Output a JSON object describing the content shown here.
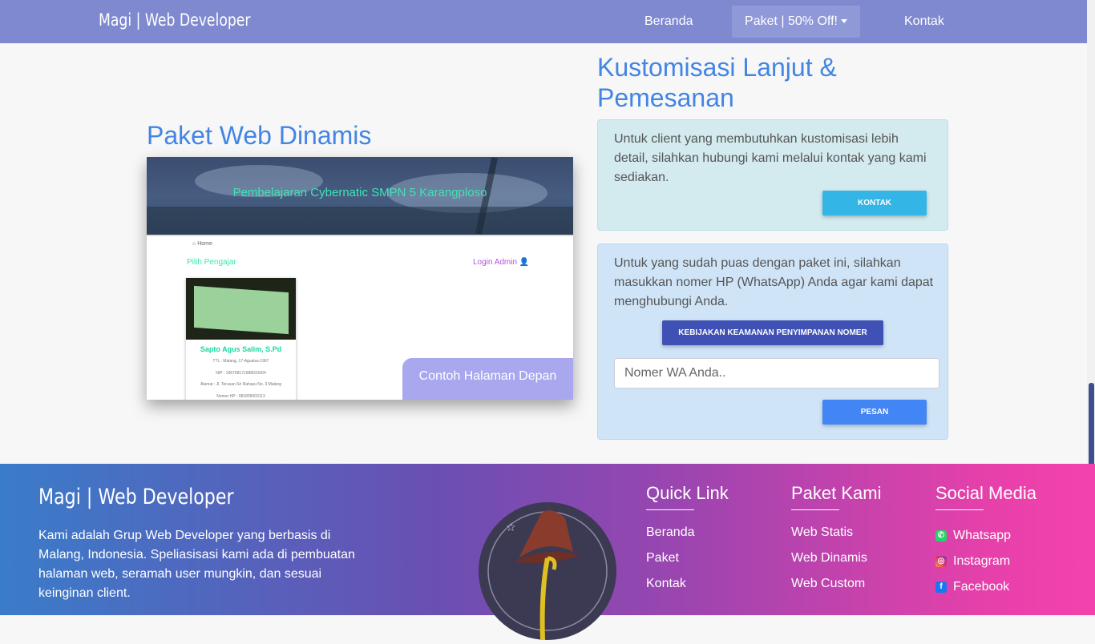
{
  "navbar": {
    "brand": "Magi | Web Developer",
    "home": "Beranda",
    "packages": "Paket | 50% Off!",
    "contact": "Kontak"
  },
  "left": {
    "title": "Paket Web Dinamis",
    "preview": {
      "hero_title": "Pembelajaran Cybernatic SMPN 5 Karangploso",
      "home_crumb": "Home",
      "choose_teacher": "Pilih Pengajar",
      "login_admin": "Login Admin",
      "card_name": "Sapto Agus Salim, S.Pd",
      "card_ttl": "TTL : Malang, 17-Agustus-1967",
      "card_nip": "NIP : 196708171998031004",
      "card_address": "Alamat : Jl. Terusan Sri Rahayu No. 3 Malang",
      "card_phone": "Nomer HP : 081805003113",
      "button": "Contoh Halaman Depan"
    }
  },
  "right": {
    "title": "Kustomisasi Lanjut & Pemesanan",
    "box1": {
      "text": "Untuk client yang membutuhkan kustomisasi lebih detail, silahkan hubungi kami melalui kontak yang kami sediakan.",
      "button": "KONTAK"
    },
    "box2": {
      "text": "Untuk yang sudah puas dengan paket ini, silahkan masukkan nomer HP (WhatsApp) Anda agar kami dapat menghubungi Anda.",
      "policy_button": "KEBIJAKAN KEAMANAN PENYIMPANAN NOMER",
      "input_placeholder": "Nomer WA Anda..",
      "submit_button": "PESAN"
    }
  },
  "footer": {
    "brand": "Magi | Web Developer",
    "description": "Kami adalah Grup Web Developer yang berbasis di Malang, Indonesia. Speliasisasi kami ada di pembuatan halaman web, seramah user mungkin, dan sesuai keinginan client.",
    "quick_link": {
      "title": "Quick Link",
      "items": [
        "Beranda",
        "Paket",
        "Kontak"
      ]
    },
    "packages": {
      "title": "Paket Kami",
      "items": [
        "Web Statis",
        "Web Dinamis",
        "Web Custom"
      ]
    },
    "social": {
      "title": "Social Media",
      "items": [
        {
          "label": "Whatsapp",
          "icon": "whatsapp-icon"
        },
        {
          "label": "Instagram",
          "icon": "instagram-icon"
        },
        {
          "label": "Facebook",
          "icon": "facebook-icon"
        }
      ]
    }
  },
  "colors": {
    "navbar": "#7f89cf",
    "accent_title": "#4285e4",
    "btn_kontak": "#33b5e5",
    "btn_policy": "#3f51b5",
    "btn_pesan": "#4285f4"
  }
}
